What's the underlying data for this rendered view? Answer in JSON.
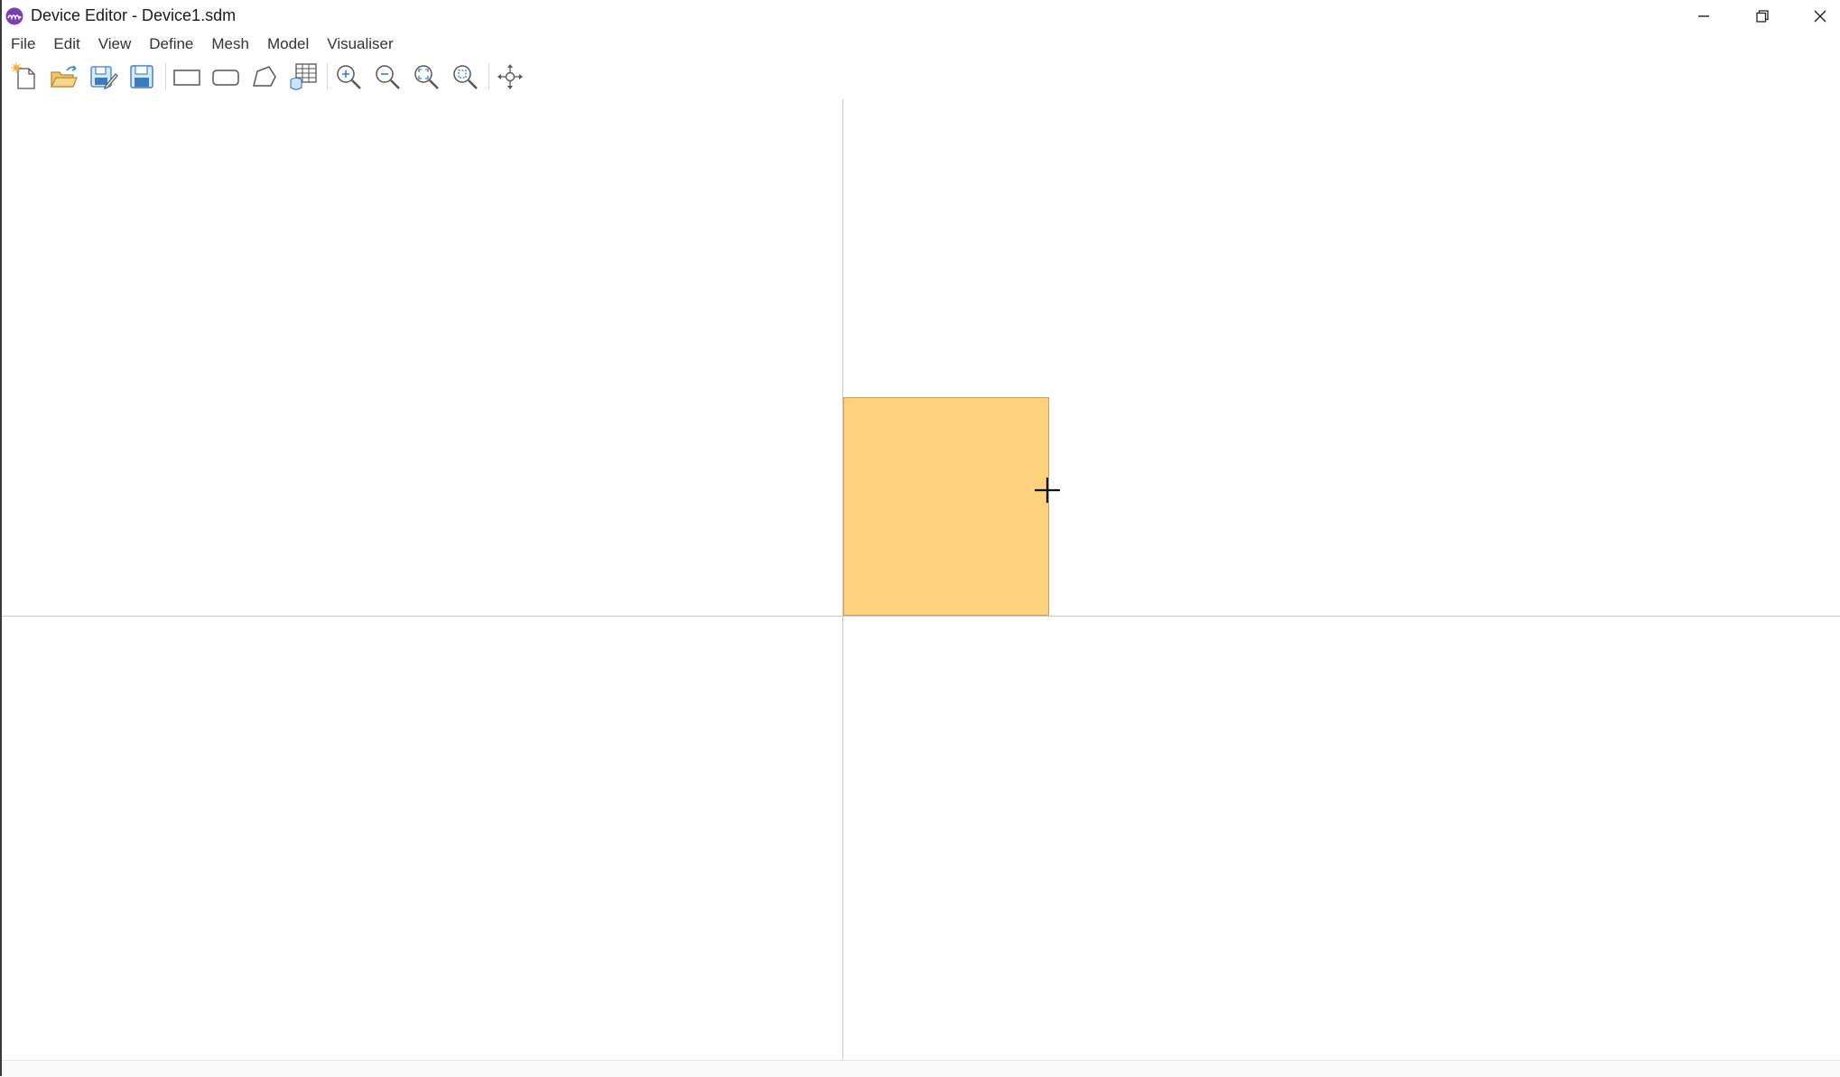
{
  "window": {
    "title": "Device Editor - Device1.sdm",
    "controls": [
      "minimize-icon",
      "restore-icon",
      "close-icon"
    ]
  },
  "menu": {
    "items": [
      {
        "label": "File"
      },
      {
        "label": "Edit"
      },
      {
        "label": "View"
      },
      {
        "label": "Define"
      },
      {
        "label": "Mesh"
      },
      {
        "label": "Model"
      },
      {
        "label": "Visualiser"
      }
    ]
  },
  "toolbar": {
    "groups": [
      [
        "new-file-icon",
        "open-folder-icon",
        "save-as-icon",
        "save-icon"
      ],
      [
        "draw-rectangle-icon",
        "draw-rounded-rectangle-icon",
        "draw-polygon-icon",
        "layer-table-icon"
      ],
      [
        "zoom-in-icon",
        "zoom-out-icon",
        "zoom-fit-icon",
        "zoom-window-icon"
      ],
      [
        "pan-icon"
      ]
    ]
  },
  "canvas": {
    "shape_color": "#ffd27f",
    "axis_color": "#c8c8c8"
  }
}
